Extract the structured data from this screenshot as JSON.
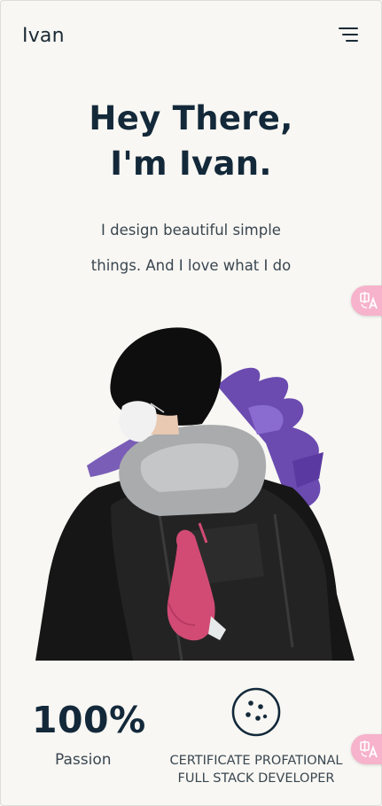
{
  "header": {
    "logo": "Ivan",
    "menu_icon": "hamburger-menu-icon"
  },
  "hero": {
    "title_line1": "Hey There,",
    "title_line2": "I'm Ivan.",
    "subtitle_line1": "I design beautiful simple",
    "subtitle_line2": "things. And I love what I do"
  },
  "translate_widget": {
    "icon": "translate-icon",
    "color": "#f6b3cb"
  },
  "portrait": {
    "brush_color": "#6b4bb0"
  },
  "stats": {
    "passion_value": "100%",
    "passion_label": "Passion",
    "cert_icon": "cookie-icon",
    "cert_line1": "CERTIFICATE PROFATIONAL",
    "cert_line2": "FULL STACK DEVELOPER"
  },
  "colors": {
    "background": "#f8f7f3",
    "text_dark": "#13293a"
  }
}
